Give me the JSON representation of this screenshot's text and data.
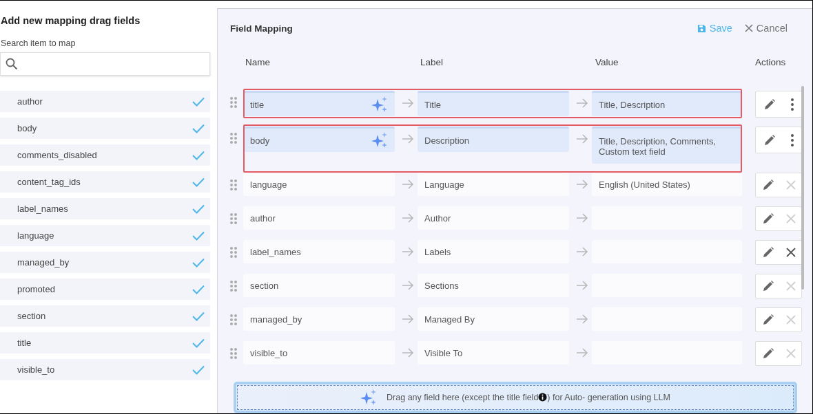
{
  "left_panel": {
    "title": "Add new mapping drag fields",
    "search": {
      "label": "Search item to map"
    },
    "items": [
      {
        "name": "author",
        "checked": true
      },
      {
        "name": "body",
        "checked": true
      },
      {
        "name": "comments_disabled",
        "checked": true
      },
      {
        "name": "content_tag_ids",
        "checked": true
      },
      {
        "name": "label_names",
        "checked": true
      },
      {
        "name": "language",
        "checked": true
      },
      {
        "name": "managed_by",
        "checked": true
      },
      {
        "name": "promoted",
        "checked": true
      },
      {
        "name": "section",
        "checked": true
      },
      {
        "name": "title",
        "checked": true
      },
      {
        "name": "visible_to",
        "checked": true
      }
    ]
  },
  "mapping": {
    "title": "Field Mapping",
    "save": "Save",
    "cancel": "Cancel",
    "columns": [
      "Name",
      "Label",
      "Value",
      "Actions"
    ],
    "rows": [
      {
        "name": "title",
        "label": "Title",
        "value": "Title, Description",
        "auto_generated": true,
        "delete_disabled": false
      },
      {
        "name": "body",
        "label": "Description",
        "value": "Title, Description, Comments, Custom text field",
        "auto_generated": true,
        "delete_disabled": false
      },
      {
        "name": "language",
        "label": "Language",
        "value": "English (United States)",
        "auto_generated": false,
        "delete_disabled": true
      },
      {
        "name": "author",
        "label": "Author",
        "value": "",
        "auto_generated": false,
        "delete_disabled": true
      },
      {
        "name": "label_names",
        "label": "Labels",
        "value": "",
        "auto_generated": false,
        "delete_disabled": false
      },
      {
        "name": "section",
        "label": "Sections",
        "value": "",
        "auto_generated": false,
        "delete_disabled": true
      },
      {
        "name": "managed_by",
        "label": "Managed By",
        "value": "",
        "auto_generated": false,
        "delete_disabled": true
      },
      {
        "name": "visible_to",
        "label": "Visible To",
        "value": "",
        "auto_generated": false,
        "delete_disabled": true
      }
    ],
    "drop_zone": {
      "text_before": "Drag any field here (except the title field",
      "text_after": ") for Auto- generation using LLM"
    }
  }
}
